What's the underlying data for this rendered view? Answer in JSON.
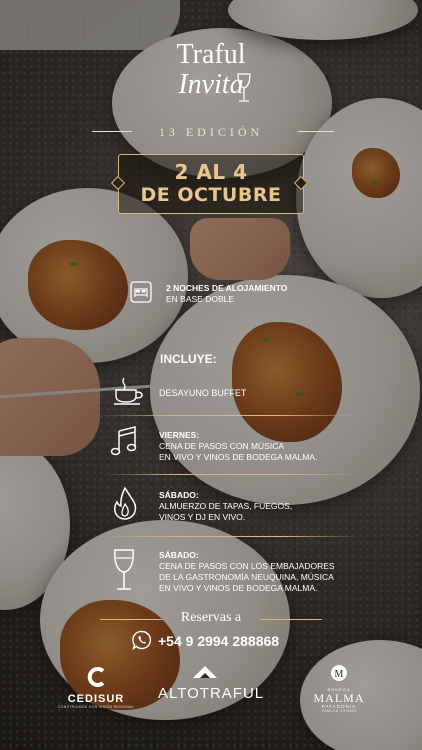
{
  "header": {
    "title_line1": "Traful",
    "title_line2": "Invita",
    "edition": "13 EDICIÓN",
    "date_line1": "2 AL 4",
    "date_line2": "DE OCTUBRE"
  },
  "lodging": {
    "title": "2 NOCHES DE ALOJAMIENTO",
    "subtitle": "EN BASE DOBLE"
  },
  "includes_heading": "INCLUYE:",
  "items": [
    {
      "icon": "coffee-cup-icon",
      "day": "",
      "line1": "DESAYUNO BUFFET",
      "line2": ""
    },
    {
      "icon": "music-note-icon",
      "day": "VIERNES:",
      "line1": "CENA DE PASOS CON MÚSICA",
      "line2": "EN VIVO Y VINOS DE BODEGA MALMA."
    },
    {
      "icon": "fire-icon",
      "day": "SÁBADO:",
      "line1": "ALMUERZO DE TAPAS, FUEGOS,",
      "line2": "VINOS Y DJ EN VIVO."
    },
    {
      "icon": "wine-glass-icon",
      "day": "SÁBADO:",
      "line1": "CENA DE PASOS CON LOS EMBAJADORES",
      "line2": "DE LA GASTRONOMÍA NEUQUINA, MÚSICA",
      "line3": "EN VIVO Y VINOS DE BODEGA MALMA."
    }
  ],
  "reservations": {
    "label": "Reservas a",
    "phone": "+54 9 2994 288868"
  },
  "sponsors": {
    "cedisur": "CEDISUR",
    "cedisur_tag": "CONSTRUIMOS CON VISIÓN REGIONAL",
    "altotraful": "ALTOTRAFUL",
    "malma_top": "BODEGA",
    "malma": "MALMA",
    "malma_sub": "PATAGONIA",
    "malma_tag": "FAMILIA VIRANO"
  },
  "colors": {
    "gold": "#e2c48a",
    "text": "#ffffff"
  }
}
